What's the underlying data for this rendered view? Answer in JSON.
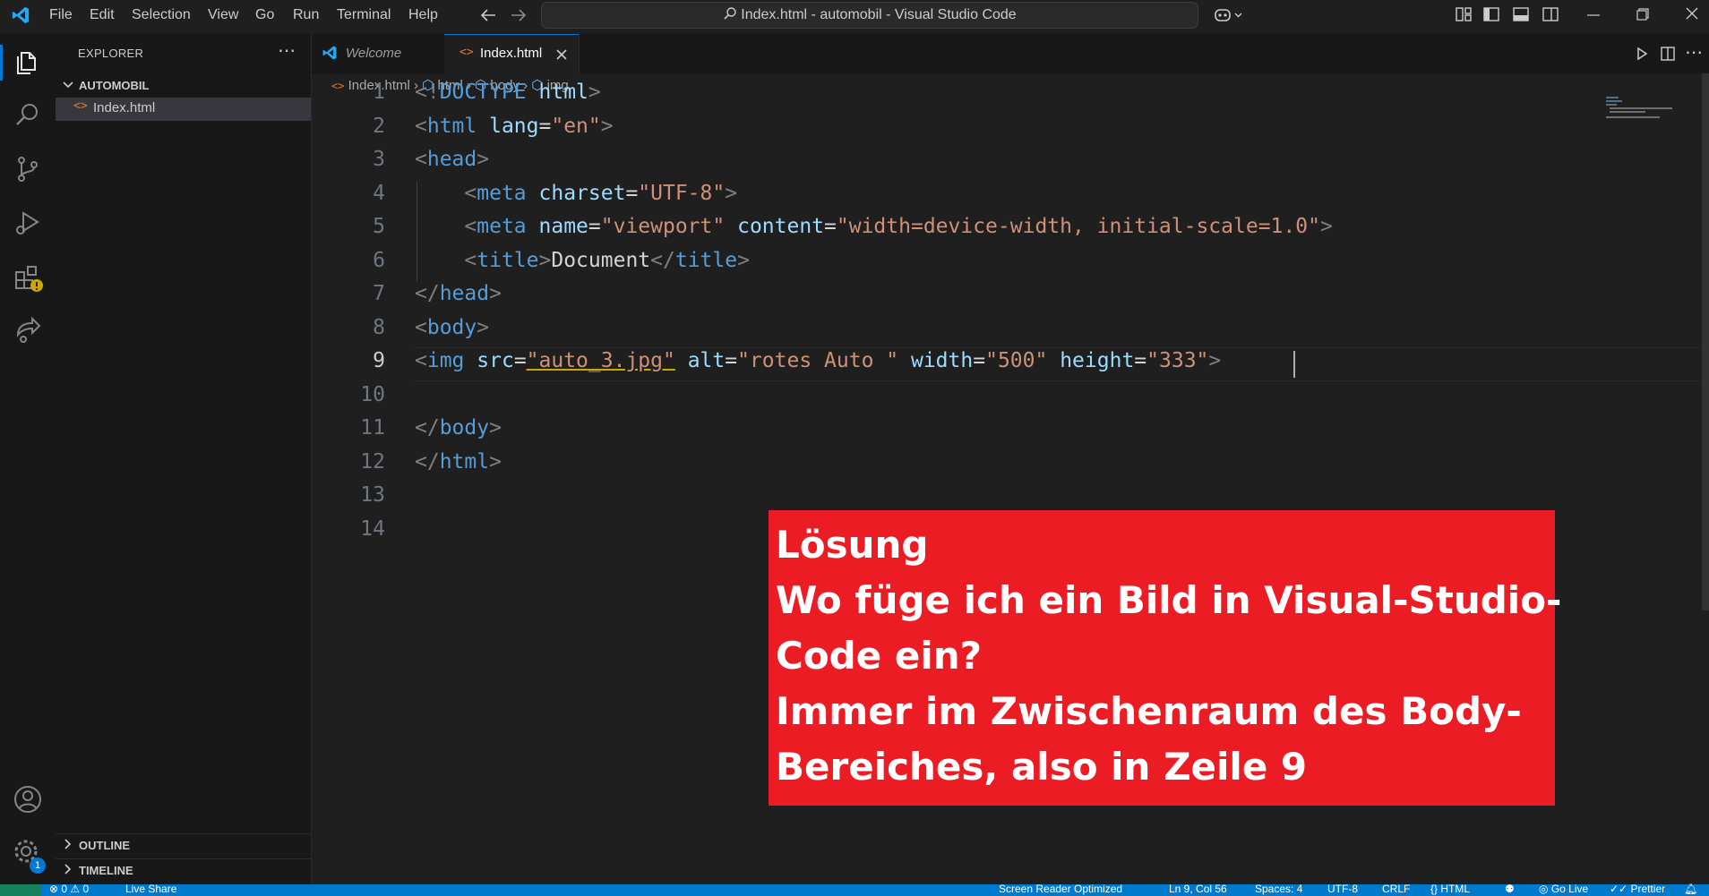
{
  "menu": [
    "File",
    "Edit",
    "Selection",
    "View",
    "Go",
    "Run",
    "Terminal",
    "Help"
  ],
  "window": {
    "title": "Index.html - automobil - Visual Studio Code"
  },
  "sidebar": {
    "title": "EXPLORER",
    "folder": "AUTOMOBIL",
    "files": [
      "Index.html"
    ],
    "outline": "OUTLINE",
    "timeline": "TIMELINE"
  },
  "tabs": [
    {
      "label": "Welcome",
      "active": false
    },
    {
      "label": "Index.html",
      "active": true
    }
  ],
  "breadcrumb": [
    "Index.html",
    "html",
    "body",
    "img"
  ],
  "editor": {
    "active_line": 9,
    "line_numbers": [
      "1",
      "2",
      "3",
      "4",
      "5",
      "6",
      "7",
      "8",
      "9",
      "10",
      "11",
      "12",
      "13",
      "14"
    ],
    "lines": [
      [
        [
          "p",
          "<!"
        ],
        [
          "t",
          "DOCTYPE"
        ],
        [
          "x",
          " "
        ],
        [
          "a",
          "html"
        ],
        [
          "p",
          ">"
        ]
      ],
      [
        [
          "p",
          "<"
        ],
        [
          "t",
          "html"
        ],
        [
          "x",
          " "
        ],
        [
          "a",
          "lang"
        ],
        [
          "x",
          "="
        ],
        [
          "v",
          "\"en\""
        ],
        [
          "p",
          ">"
        ]
      ],
      [
        [
          "p",
          "<"
        ],
        [
          "t",
          "head"
        ],
        [
          "p",
          ">"
        ]
      ],
      [
        [
          "x",
          "    "
        ],
        [
          "p",
          "<"
        ],
        [
          "t",
          "meta"
        ],
        [
          "x",
          " "
        ],
        [
          "a",
          "charset"
        ],
        [
          "x",
          "="
        ],
        [
          "v",
          "\"UTF-8\""
        ],
        [
          "p",
          ">"
        ]
      ],
      [
        [
          "x",
          "    "
        ],
        [
          "p",
          "<"
        ],
        [
          "t",
          "meta"
        ],
        [
          "x",
          " "
        ],
        [
          "a",
          "name"
        ],
        [
          "x",
          "="
        ],
        [
          "v",
          "\"viewport\""
        ],
        [
          "x",
          " "
        ],
        [
          "a",
          "content"
        ],
        [
          "x",
          "="
        ],
        [
          "v",
          "\"width=device-width, initial-scale=1.0\""
        ],
        [
          "p",
          ">"
        ]
      ],
      [
        [
          "x",
          "    "
        ],
        [
          "p",
          "<"
        ],
        [
          "t",
          "title"
        ],
        [
          "p",
          ">"
        ],
        [
          "x",
          "Document"
        ],
        [
          "p",
          "</"
        ],
        [
          "t",
          "title"
        ],
        [
          "p",
          ">"
        ]
      ],
      [
        [
          "p",
          "</"
        ],
        [
          "t",
          "head"
        ],
        [
          "p",
          ">"
        ]
      ],
      [
        [
          "p",
          "<"
        ],
        [
          "t",
          "body"
        ],
        [
          "p",
          ">"
        ]
      ],
      [
        [
          "p",
          "<"
        ],
        [
          "t",
          "img"
        ],
        [
          "x",
          " "
        ],
        [
          "a",
          "src"
        ],
        [
          "x",
          "="
        ],
        [
          "v",
          "\"auto_3.jpg\""
        ],
        [
          "x",
          " "
        ],
        [
          "a",
          "alt"
        ],
        [
          "x",
          "="
        ],
        [
          "v",
          "\"rotes Auto \""
        ],
        [
          "x",
          " "
        ],
        [
          "a",
          "width"
        ],
        [
          "x",
          "="
        ],
        [
          "v",
          "\"500\""
        ],
        [
          "x",
          " "
        ],
        [
          "a",
          "height"
        ],
        [
          "x",
          "="
        ],
        [
          "v",
          "\"333\""
        ],
        [
          "p",
          ">"
        ]
      ],
      [],
      [
        [
          "p",
          "</"
        ],
        [
          "t",
          "body"
        ],
        [
          "p",
          ">"
        ]
      ],
      [
        [
          "p",
          "</"
        ],
        [
          "t",
          "html"
        ],
        [
          "p",
          ">"
        ]
      ],
      [],
      []
    ]
  },
  "overlay": {
    "lines": [
      "Lösung",
      "Wo füge ich ein Bild in Visual-Studio-",
      "Code ein?",
      "Immer im Zwischenraum des Body-",
      "Bereiches, also in Zeile 9"
    ]
  },
  "statusbar": {
    "errors": "0",
    "warnings": "0",
    "liveshare": "Live Share",
    "screen_reader": "Screen Reader Optimized",
    "position": "Ln 9, Col 56",
    "spaces": "Spaces: 4",
    "encoding": "UTF-8",
    "eol": "CRLF",
    "language": "HTML",
    "golive": "Go Live",
    "prettier": "Prettier"
  },
  "badges": {
    "settings": "1"
  },
  "colors": {
    "accent": "#007acc",
    "overlay": "#ec1c24",
    "vscode_blue": "#23a9f2"
  }
}
